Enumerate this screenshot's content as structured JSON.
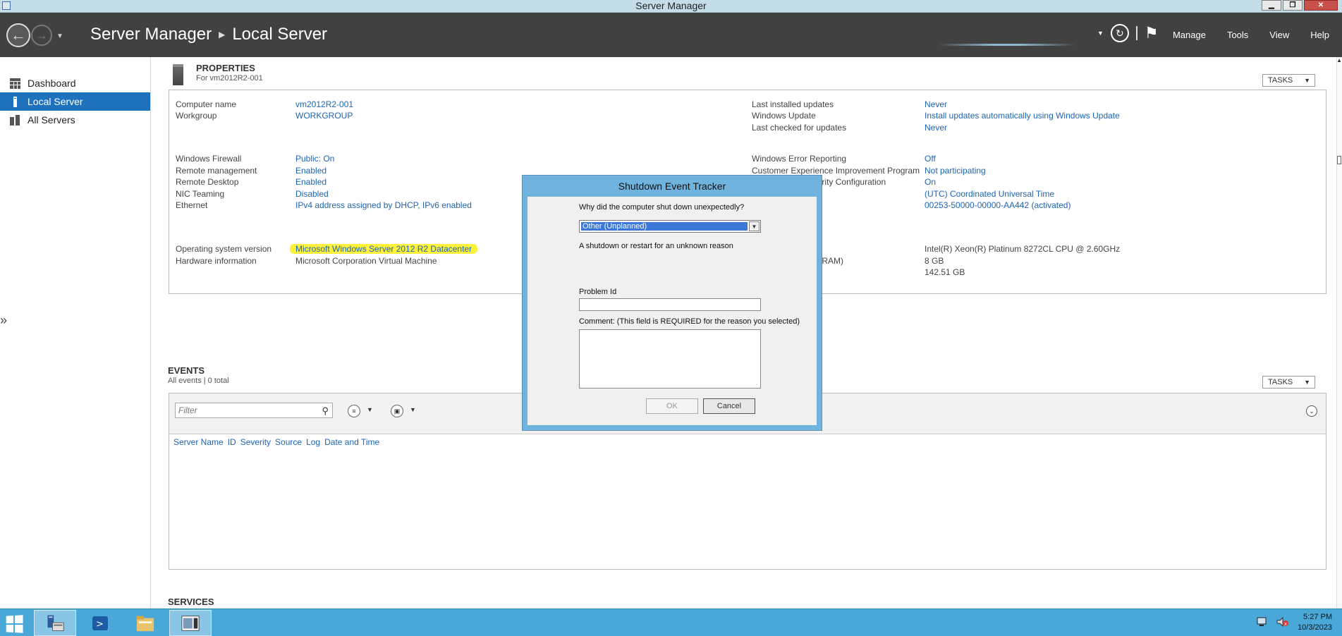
{
  "window": {
    "title": "Server Manager",
    "controls": [
      "▁",
      "❐",
      "✕"
    ]
  },
  "header": {
    "breadcrumb": [
      "Server Manager",
      "Local Server"
    ],
    "menu": [
      "Manage",
      "Tools",
      "View",
      "Help"
    ]
  },
  "sidebar": {
    "items": [
      {
        "label": "Dashboard",
        "icon": "dashboard-icon"
      },
      {
        "label": "Local Server",
        "icon": "local-server-icon",
        "active": true
      },
      {
        "label": "All Servers",
        "icon": "all-servers-icon"
      }
    ],
    "expand_glyph": "»"
  },
  "properties": {
    "title": "PROPERTIES",
    "subtitle": "For vm2012R2-001",
    "tasks_label": "TASKS",
    "left": [
      {
        "label": "Computer name",
        "value": "vm2012R2-001",
        "link": true
      },
      {
        "label": "Workgroup",
        "value": "WORKGROUP",
        "link": true
      },
      {
        "label": "Windows Firewall",
        "value": "Public: On",
        "link": true
      },
      {
        "label": "Remote management",
        "value": "Enabled",
        "link": true
      },
      {
        "label": "Remote Desktop",
        "value": "Enabled",
        "link": true
      },
      {
        "label": "NIC Teaming",
        "value": "Disabled",
        "link": true
      },
      {
        "label": "Ethernet",
        "value": "IPv4 address assigned by DHCP, IPv6 enabled",
        "link": true
      },
      {
        "label": "Operating system version",
        "value": "Microsoft Windows Server 2012 R2 Datacenter",
        "link": true,
        "highlight": true
      },
      {
        "label": "Hardware information",
        "value": "Microsoft Corporation Virtual Machine",
        "link": false
      }
    ],
    "right": [
      {
        "label": "Last installed updates",
        "value": "Never"
      },
      {
        "label": "Windows Update",
        "value": "Install updates automatically using Windows Update"
      },
      {
        "label": "Last checked for updates",
        "value": "Never"
      },
      {
        "label": "Windows Error Reporting",
        "value": "Off"
      },
      {
        "label": "Customer Experience Improvement Program",
        "value": "Not participating"
      },
      {
        "label": "IE Enhanced Security Configuration",
        "value": "On"
      },
      {
        "label": "",
        "value": "(UTC) Coordinated Universal Time"
      },
      {
        "label": "",
        "value": "00253-50000-00000-AA442 (activated)"
      },
      {
        "label": "",
        "value": "Intel(R) Xeon(R) Platinum 8272CL CPU @ 2.60GHz",
        "plain": true
      },
      {
        "label": "RAM)",
        "value": "8 GB",
        "plain": true
      },
      {
        "label": "",
        "value": "142.51 GB",
        "plain": true
      }
    ]
  },
  "events": {
    "title": "EVENTS",
    "subtitle": "All events | 0 total",
    "tasks_label": "TASKS",
    "filter_placeholder": "Filter",
    "columns": [
      "Server Name",
      "ID",
      "Severity",
      "Source",
      "Log",
      "Date and Time"
    ]
  },
  "services": {
    "title": "SERVICES"
  },
  "dialog": {
    "title": "Shutdown Event Tracker",
    "question": "Why did the computer shut down unexpectedly?",
    "selected_reason": "Other (Unplanned)",
    "reason_description": "A shutdown or restart for an unknown reason",
    "problem_id_label": "Problem Id",
    "comment_label": "Comment: (This field is REQUIRED for the reason you selected)",
    "ok_label": "OK",
    "cancel_label": "Cancel"
  },
  "taskbar": {
    "time": "5:27 PM",
    "date": "10/3/2023"
  },
  "colors": {
    "accent": "#1e72bd",
    "link": "#1e64b4",
    "header": "#414141",
    "taskbar": "#4aa8d8",
    "highlight": "#fdf13b"
  }
}
